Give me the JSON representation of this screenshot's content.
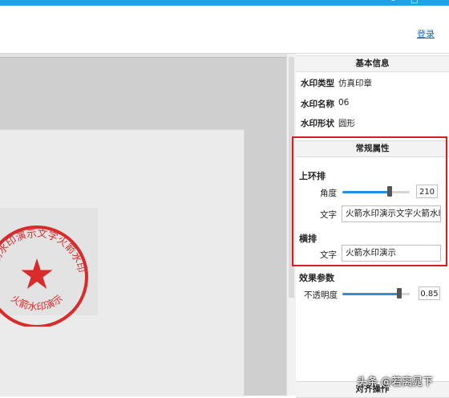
{
  "window": {
    "controls": [
      "–",
      "□"
    ]
  },
  "toolbar": {
    "login": "登录"
  },
  "seal": {
    "top_text": "火箭水印演示文字火箭水印",
    "bottom_text": "火箭水印演示",
    "color": "#d92b2b"
  },
  "panel": {
    "basic": {
      "header": "基本信息",
      "rows": [
        {
          "label": "水印类型",
          "value": "仿真印章"
        },
        {
          "label": "水印名称",
          "value": "06"
        },
        {
          "label": "水印形状",
          "value": "圆形"
        }
      ]
    },
    "general": {
      "header": "常规属性",
      "upper_ring": {
        "title": "上环排",
        "angle_label": "角度",
        "angle_value": "210",
        "angle_slider": 0.7,
        "text_label": "文字",
        "text_value": "火箭水印演示文字火箭水印"
      },
      "horizontal": {
        "title": "横排",
        "text_label": "文字",
        "text_value": "火箭水印演示"
      }
    },
    "effect": {
      "title": "效果参数",
      "opacity_label": "不透明度",
      "opacity_value": "0.85",
      "opacity_slider": 0.85
    },
    "align": {
      "header": "对齐操作"
    }
  },
  "overlay": {
    "watermark": "头条 @若离晁下"
  },
  "colors": {
    "accent": "#1aa3e8",
    "highlight": "#d62020",
    "slider_fill": "#2b8fe0"
  }
}
